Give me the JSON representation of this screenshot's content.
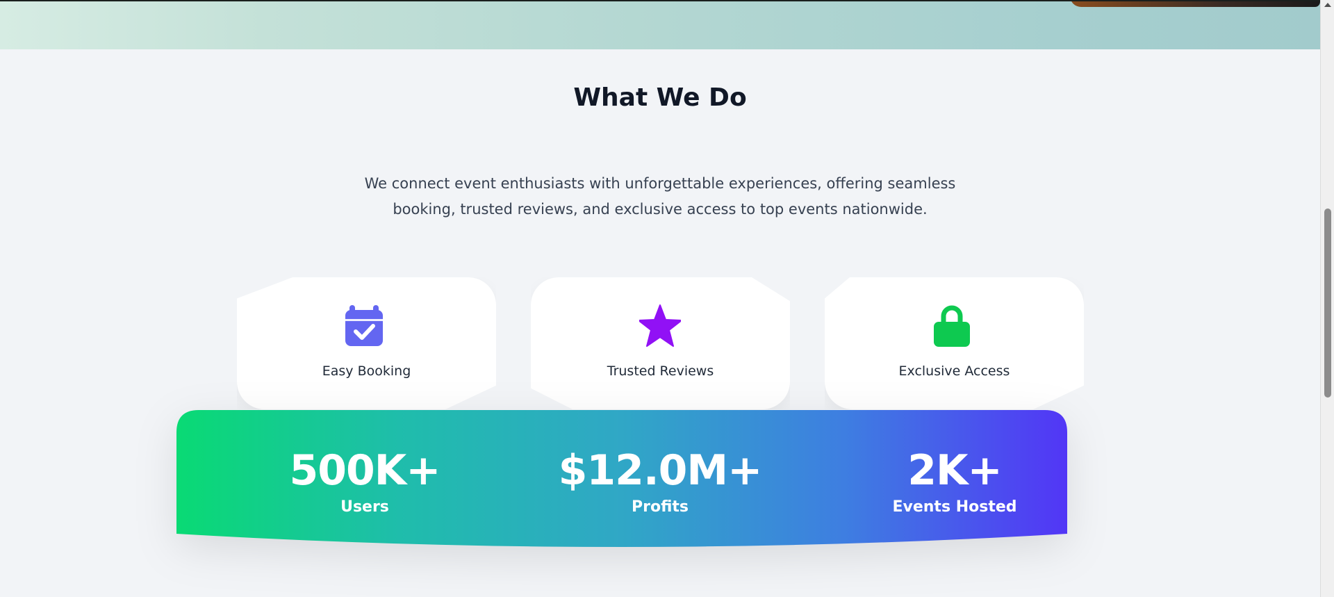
{
  "section": {
    "title": "What We Do",
    "description": "We connect event enthusiasts with unforgettable experiences, offering seamless booking, trusted reviews, and exclusive access to top events nationwide."
  },
  "features": [
    {
      "label": "Easy Booking",
      "icon": "calendar-check-icon",
      "color": "#6366f1"
    },
    {
      "label": "Trusted Reviews",
      "icon": "star-icon",
      "color": "#9111f5"
    },
    {
      "label": "Exclusive Access",
      "icon": "lock-icon",
      "color": "#0ec950"
    }
  ],
  "stats": [
    {
      "value": "500K+",
      "label": "Users"
    },
    {
      "value": "$12.0M+",
      "label": "Profits"
    },
    {
      "value": "2K+",
      "label": "Events Hosted"
    }
  ],
  "colors": {
    "background": "#f2f4f7",
    "heading": "#111827",
    "body_text": "#374151",
    "banner_gradient_start": "#09da74",
    "banner_gradient_mid": "#30a7c6",
    "banner_gradient_end": "#5236f6"
  }
}
